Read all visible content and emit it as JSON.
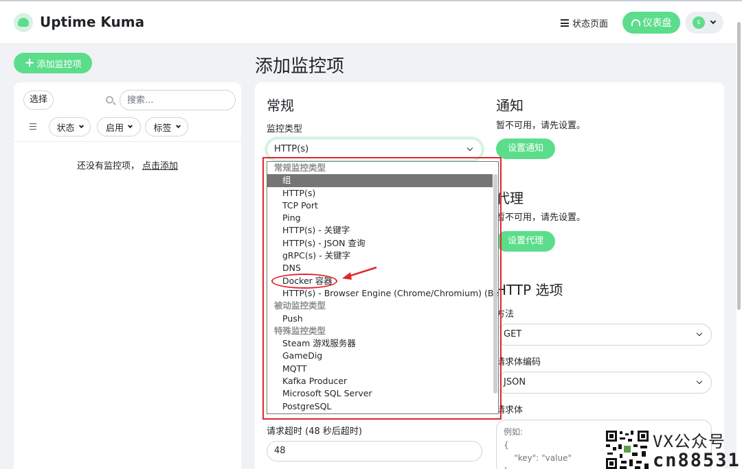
{
  "header": {
    "brand": "Uptime Kuma",
    "status_page_label": "状态页面",
    "dashboard_label": "仪表盘",
    "avatar_letter": "s"
  },
  "sidebar": {
    "add_monitor_label": "添加监控项",
    "select_label": "选择",
    "search_placeholder": "搜索...",
    "filters": [
      "状态",
      "启用",
      "标签"
    ],
    "empty_text": "还没有监控项，",
    "empty_link": "点击添加"
  },
  "main": {
    "page_title": "添加监控项",
    "general": {
      "heading": "常规",
      "monitor_type_label": "监控类型",
      "monitor_type_value": "HTTP(s)",
      "timeout_label": "请求超时 (48 秒后超时)",
      "timeout_value": "48"
    },
    "notification": {
      "heading": "通知",
      "hint": "暂不可用，请先设置。",
      "button": "设置通知"
    },
    "proxy": {
      "heading": "代理",
      "hint": "暂不可用，请先设置。",
      "button": "设置代理"
    },
    "http_options": {
      "heading": "HTTP 选项",
      "method_label": "方法",
      "method_value": "GET",
      "body_encoding_label": "请求体编码",
      "body_encoding_value": "JSON",
      "body_label": "请求体",
      "body_placeholder_lines": [
        "例如:",
        "{",
        "    \"key\": \"value\"",
        "}"
      ]
    }
  },
  "dropdown": {
    "rows": [
      {
        "kind": "group",
        "label": "常规监控类型"
      },
      {
        "kind": "item",
        "label": "组",
        "selected": true
      },
      {
        "kind": "item",
        "label": "HTTP(s)"
      },
      {
        "kind": "item",
        "label": "TCP Port"
      },
      {
        "kind": "item",
        "label": "Ping"
      },
      {
        "kind": "item",
        "label": "HTTP(s) - 关键字"
      },
      {
        "kind": "item",
        "label": "HTTP(s) - JSON 查询"
      },
      {
        "kind": "item",
        "label": "gRPC(s) - 关键字"
      },
      {
        "kind": "item",
        "label": "DNS"
      },
      {
        "kind": "item",
        "label": "Docker 容器"
      },
      {
        "kind": "item",
        "label": "HTTP(s) - Browser Engine (Chrome/Chromium) (Beta)"
      },
      {
        "kind": "group",
        "label": "被动监控类型"
      },
      {
        "kind": "item",
        "label": "Push"
      },
      {
        "kind": "group",
        "label": "特殊监控类型"
      },
      {
        "kind": "item",
        "label": "Steam 游戏服务器"
      },
      {
        "kind": "item",
        "label": "GameDig"
      },
      {
        "kind": "item",
        "label": "MQTT"
      },
      {
        "kind": "item",
        "label": "Kafka Producer"
      },
      {
        "kind": "item",
        "label": "Microsoft SQL Server"
      },
      {
        "kind": "item",
        "label": "PostgreSQL"
      }
    ]
  },
  "watermark": {
    "line1": "VX公众号",
    "line2": "cn88531"
  },
  "colors": {
    "accent": "#5cdd8b",
    "annotation_red": "#e0252d"
  }
}
